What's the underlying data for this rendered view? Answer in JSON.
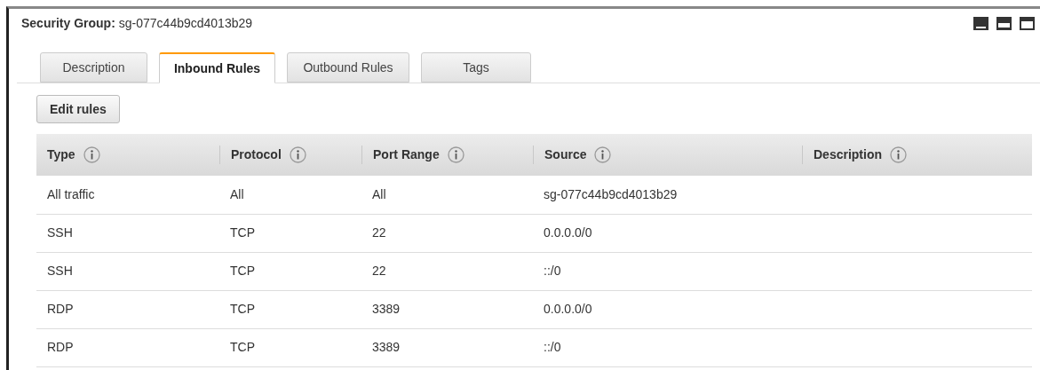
{
  "header": {
    "label": "Security Group:",
    "value": "sg-077c44b9cd4013b29"
  },
  "tabs": [
    {
      "label": "Description",
      "selected": false
    },
    {
      "label": "Inbound Rules",
      "selected": true
    },
    {
      "label": "Outbound Rules",
      "selected": false
    },
    {
      "label": "Tags",
      "selected": false
    }
  ],
  "edit_button": "Edit rules",
  "table": {
    "columns": [
      "Type",
      "Protocol",
      "Port Range",
      "Source",
      "Description"
    ],
    "rows": [
      [
        "All traffic",
        "All",
        "All",
        "sg-077c44b9cd4013b29"
      ],
      [
        "SSH",
        "TCP",
        "22",
        "0.0.0.0/0"
      ],
      [
        "SSH",
        "TCP",
        "22",
        "::/0"
      ],
      [
        "RDP",
        "TCP",
        "3389",
        "0.0.0.0/0"
      ],
      [
        "RDP",
        "TCP",
        "3389",
        "::/0"
      ]
    ]
  }
}
